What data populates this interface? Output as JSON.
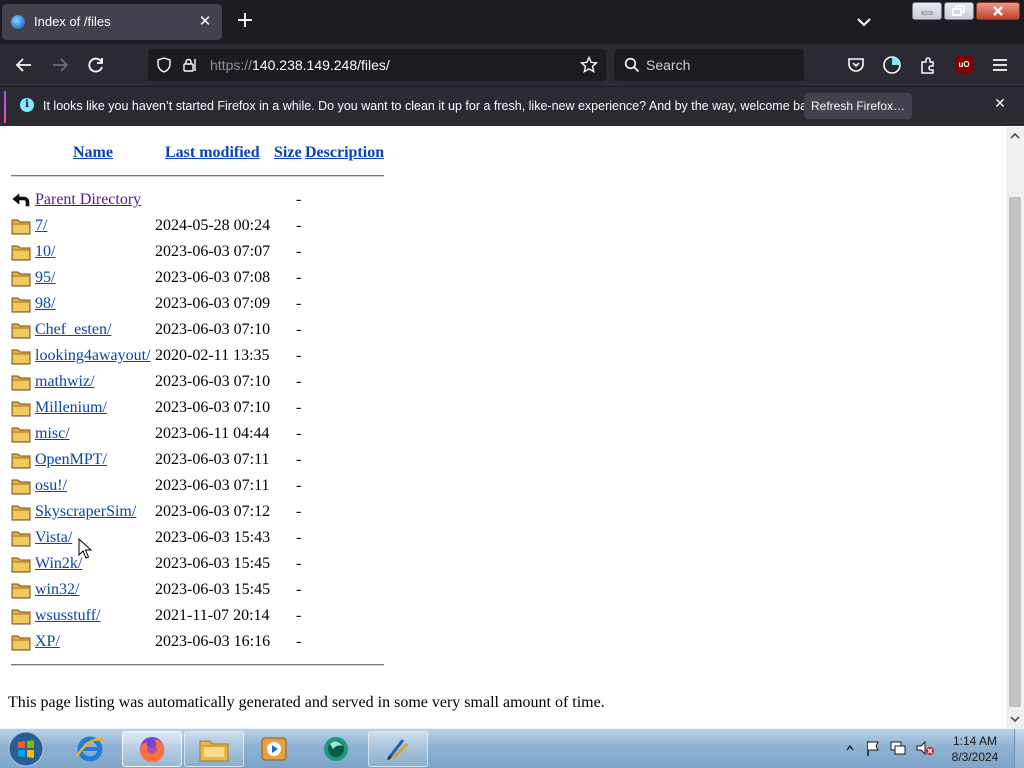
{
  "browser": {
    "tab_title": "Index of /files",
    "url_scheme": "https://",
    "url_rest": "140.238.149.248/files/",
    "search_placeholder": "Search",
    "notification": {
      "message": "It looks like you haven’t started Firefox in a while. Do you want to clean it up for a fresh, like-new experience? And by the way, welcome back!",
      "button_label": "Refresh Firefox…"
    },
    "ublock_label": "uO"
  },
  "listing": {
    "headers": {
      "name": "Name",
      "last_modified": "Last modified",
      "size": "Size",
      "description": "Description"
    },
    "parent": {
      "name": "Parent Directory",
      "size": "-"
    },
    "entries": [
      {
        "name": "7/",
        "date": "2024-05-28 00:24",
        "size": "-"
      },
      {
        "name": "10/",
        "date": "2023-06-03 07:07",
        "size": "-"
      },
      {
        "name": "95/",
        "date": "2023-06-03 07:08",
        "size": "-"
      },
      {
        "name": "98/",
        "date": "2023-06-03 07:09",
        "size": "-"
      },
      {
        "name": "Chef_esten/",
        "date": "2023-06-03 07:10",
        "size": "-"
      },
      {
        "name": "looking4awayout/",
        "date": "2020-02-11 13:35",
        "size": "-"
      },
      {
        "name": "mathwiz/",
        "date": "2023-06-03 07:10",
        "size": "-"
      },
      {
        "name": "Millenium/",
        "date": "2023-06-03 07:10",
        "size": "-"
      },
      {
        "name": "misc/",
        "date": "2023-06-11 04:44",
        "size": "-"
      },
      {
        "name": "OpenMPT/",
        "date": "2023-06-03 07:11",
        "size": "-"
      },
      {
        "name": "osu!/",
        "date": "2023-06-03 07:11",
        "size": "-"
      },
      {
        "name": "SkyscraperSim/",
        "date": "2023-06-03 07:12",
        "size": "-"
      },
      {
        "name": "Vista/",
        "date": "2023-06-03 15:43",
        "size": "-"
      },
      {
        "name": "Win2k/",
        "date": "2023-06-03 15:45",
        "size": "-"
      },
      {
        "name": "win32/",
        "date": "2023-06-03 15:45",
        "size": "-"
      },
      {
        "name": "wsusstuff/",
        "date": "2021-11-07 20:14",
        "size": "-"
      },
      {
        "name": "XP/",
        "date": "2023-06-03 16:16",
        "size": "-"
      }
    ],
    "footer": "This page listing was automatically generated and served in some very small amount of time."
  },
  "taskbar": {
    "time": "1:14 AM",
    "date": "8/3/2024",
    "apps": [
      "internet-explorer",
      "firefox",
      "file-explorer",
      "media-player",
      "app-green",
      "app-paint"
    ]
  },
  "colors": {
    "link": "#0645ad",
    "visited_link": "#551a8b",
    "chrome_dark": "#1c1b22",
    "toolbar": "#2b2a33"
  }
}
